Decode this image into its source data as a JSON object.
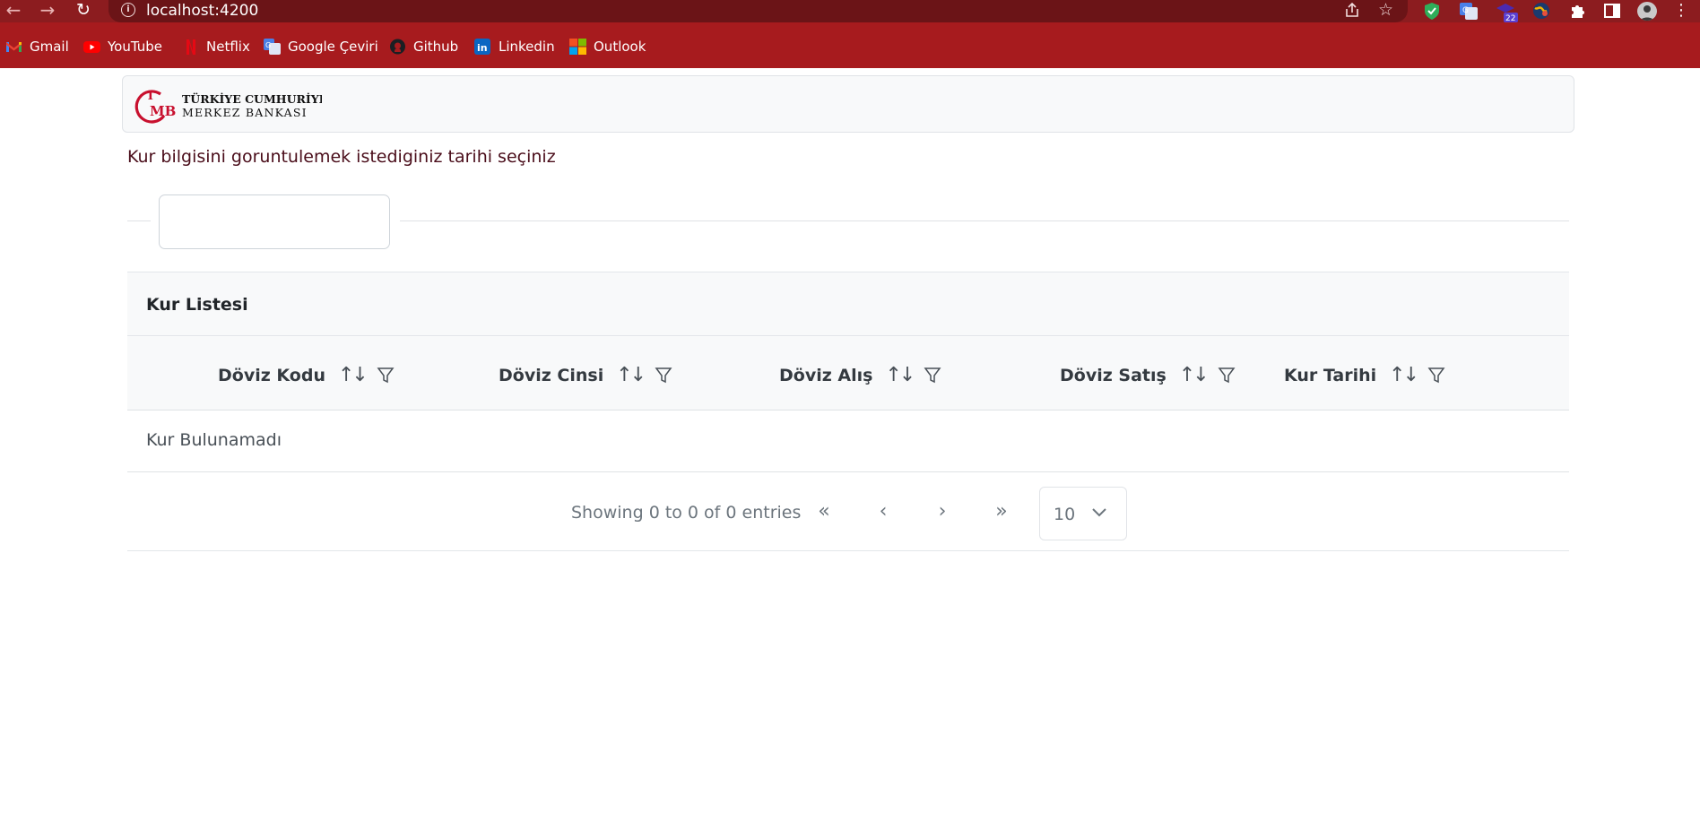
{
  "browser": {
    "url": "localhost:4200",
    "bookmarks": [
      {
        "label": "Gmail",
        "icon": "gmail-icon"
      },
      {
        "label": "YouTube",
        "icon": "youtube-icon"
      },
      {
        "label": "Netflix",
        "icon": "netflix-icon"
      },
      {
        "label": "Google Çeviri",
        "icon": "google-translate-icon"
      },
      {
        "label": "Github",
        "icon": "github-icon"
      },
      {
        "label": "Linkedin",
        "icon": "linkedin-icon"
      },
      {
        "label": "Outlook",
        "icon": "outlook-icon"
      }
    ],
    "extension_badge": "22"
  },
  "brand": {
    "monogram": "TCMB",
    "line1": "TÜRKİYE CUMHURİYET",
    "line2": "MERKEZ BANKASI",
    "color": "#c8102e"
  },
  "prompt": "Kur bilgisini goruntulemek istediginiz tarihi seçiniz",
  "date_input": {
    "value": "",
    "placeholder": ""
  },
  "table": {
    "title": "Kur Listesi",
    "columns": [
      "Döviz Kodu",
      "Döviz Cinsi",
      "Döviz Alış",
      "Döviz Satış",
      "Kur Tarihi"
    ],
    "empty_message": "Kur Bulunamadı",
    "paginator": {
      "info": "Showing 0 to 0 of 0 entries",
      "first": "«",
      "prev": "‹",
      "next": "›",
      "last": "»",
      "rows_per_page": "10"
    }
  },
  "colors": {
    "chrome_dark": "#8c1c1f",
    "bookmark_bar": "#a71b1e",
    "prompt_text": "#4a0d1a"
  }
}
